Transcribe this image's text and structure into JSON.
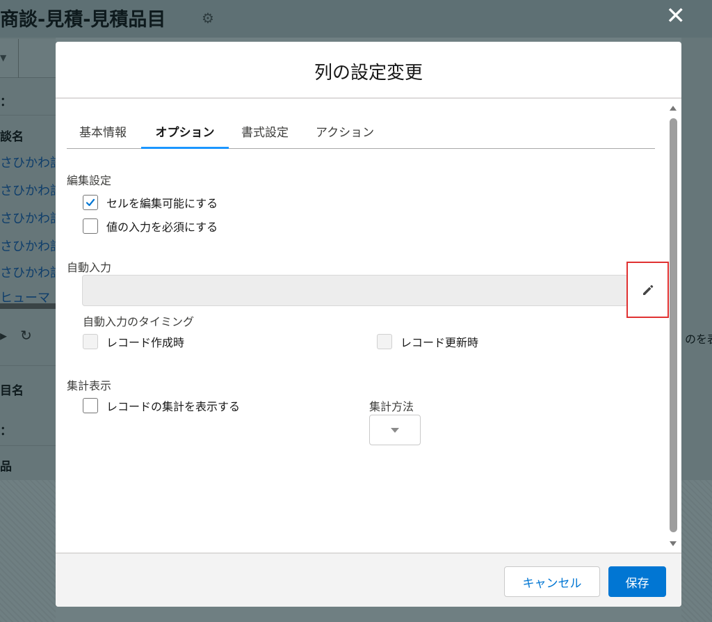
{
  "background": {
    "page_title": "商談-見積-見積品目",
    "filter_label_1": "：",
    "column_header_1": "談名",
    "rows": [
      "さひかわ記",
      "さひかわ記",
      "さひかわ記",
      "さひかわ記",
      "さひかわ記",
      "ヒューマ"
    ],
    "right_text": "のを表示",
    "column_header_2": "目名",
    "filter_label_2": "：",
    "column_header_3": "品"
  },
  "modal": {
    "title": "列の設定変更",
    "tabs": [
      {
        "label": "基本情報",
        "active": false
      },
      {
        "label": "オプション",
        "active": true
      },
      {
        "label": "書式設定",
        "active": false
      },
      {
        "label": "アクション",
        "active": false
      }
    ],
    "edit_settings": {
      "label": "編集設定",
      "options": [
        {
          "label": "セルを編集可能にする",
          "checked": true
        },
        {
          "label": "値の入力を必須にする",
          "checked": false
        }
      ]
    },
    "auto_input": {
      "label": "自動入力",
      "value": "",
      "timing_label": "自動入力のタイミング",
      "timing_options": [
        {
          "label": "レコード作成時",
          "checked": false,
          "disabled": true
        },
        {
          "label": "レコード更新時",
          "checked": false,
          "disabled": true
        }
      ]
    },
    "summary": {
      "label": "集計表示",
      "show_label": "レコードの集計を表示する",
      "show_checked": false,
      "method_label": "集計方法",
      "method_value": ""
    },
    "footer": {
      "cancel_label": "キャンセル",
      "save_label": "保存"
    }
  },
  "colors": {
    "brand_blue": "#0176d3",
    "tab_underline": "#1b96ff",
    "highlight_red": "#e03131",
    "overlay": "#5e7074"
  },
  "icons": {
    "close": "close-icon",
    "gear": "gear-icon",
    "pencil": "pencil-icon",
    "dropdown": "chevron-down-icon",
    "check": "check-icon"
  }
}
